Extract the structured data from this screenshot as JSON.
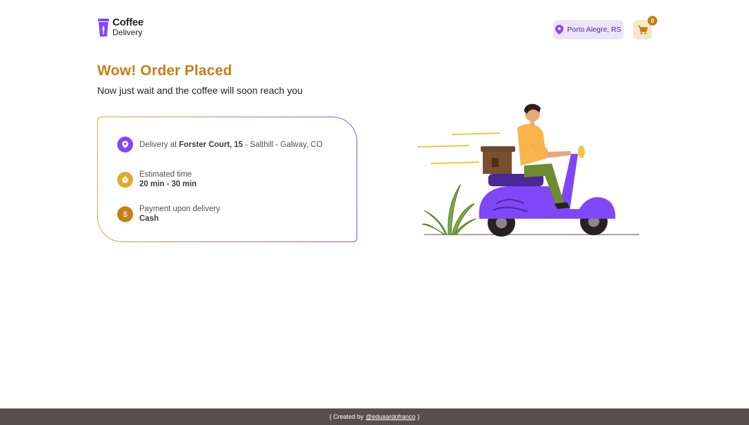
{
  "header": {
    "logo": {
      "title": "Coffee",
      "subtitle": "Delivery"
    },
    "location": "Porto Alegre, RS",
    "cart_count": "0"
  },
  "main": {
    "title": "Wow! Order Placed",
    "subtitle": "Now just wait and the coffee will soon reach you",
    "info": {
      "delivery_prefix": "Delivery at",
      "delivery_street": "Forster Court, 15",
      "delivery_rest": "- Salthill - Galway, CO",
      "time_label": "Estimated time",
      "time_value": "20 min - 30 min",
      "payment_label": "Payment upon delivery",
      "payment_value": "Cash"
    }
  },
  "footer": {
    "prefix": "{ Created by",
    "author": "@eduaardofranco",
    "suffix": "}"
  },
  "colors": {
    "purple": "#8047F8",
    "purple_light": "#EBE5F9",
    "yellow": "#DBAC2C",
    "yellow_dark": "#C47F17",
    "yellow_light": "#F1E9C9"
  },
  "icons": [
    "coffee-cup-logo-icon",
    "map-pin-icon",
    "shopping-cart-icon",
    "timer-icon",
    "currency-dollar-icon"
  ]
}
